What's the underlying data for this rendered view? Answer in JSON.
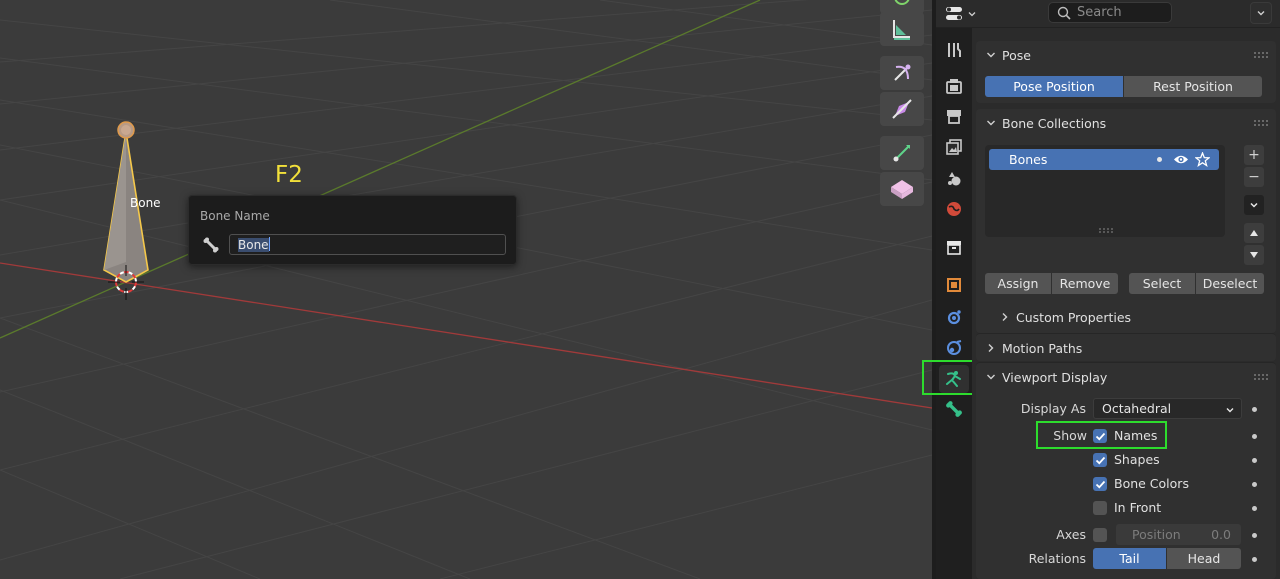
{
  "viewport": {
    "bone_label": "Bone",
    "key_hint": "F2",
    "rename_popup": {
      "title": "Bone Name",
      "value": "Bone"
    }
  },
  "header": {
    "search_placeholder": "Search"
  },
  "tabs": [
    {
      "name": "tool-icon"
    },
    {
      "name": "render-icon"
    },
    {
      "name": "output-icon"
    },
    {
      "name": "view-layer-icon"
    },
    {
      "name": "scene-icon"
    },
    {
      "name": "world-icon"
    },
    {
      "name": "collection-icon"
    },
    {
      "name": "object-icon"
    },
    {
      "name": "modifiers-icon"
    },
    {
      "name": "physics-icon"
    },
    {
      "name": "armature-data-icon"
    },
    {
      "name": "bone-icon"
    }
  ],
  "pose": {
    "title": "Pose",
    "pose_position": "Pose Position",
    "rest_position": "Rest Position",
    "active": "Pose Position"
  },
  "bone_collections": {
    "title": "Bone Collections",
    "items": [
      {
        "label": "Bones"
      }
    ],
    "assign": "Assign",
    "remove": "Remove",
    "select": "Select",
    "deselect": "Deselect",
    "custom_properties": "Custom Properties"
  },
  "motion_paths": {
    "title": "Motion Paths"
  },
  "viewport_display": {
    "title": "Viewport Display",
    "display_as_label": "Display As",
    "display_as_value": "Octahedral",
    "show_label": "Show",
    "names": {
      "label": "Names",
      "checked": true
    },
    "shapes": {
      "label": "Shapes",
      "checked": true
    },
    "bone_colors": {
      "label": "Bone Colors",
      "checked": true
    },
    "in_front": {
      "label": "In Front",
      "checked": false
    },
    "axes_label": "Axes",
    "axes_position_label": "Position",
    "axes_position_value": "0.0",
    "relations_label": "Relations",
    "tail": "Tail",
    "head": "Head",
    "relations_active": "Tail"
  },
  "colors": {
    "accent": "#4772b3",
    "highlight": "#2ddc2d",
    "hint": "#f2e03a",
    "active_bone_outline": "#f5c84a"
  }
}
